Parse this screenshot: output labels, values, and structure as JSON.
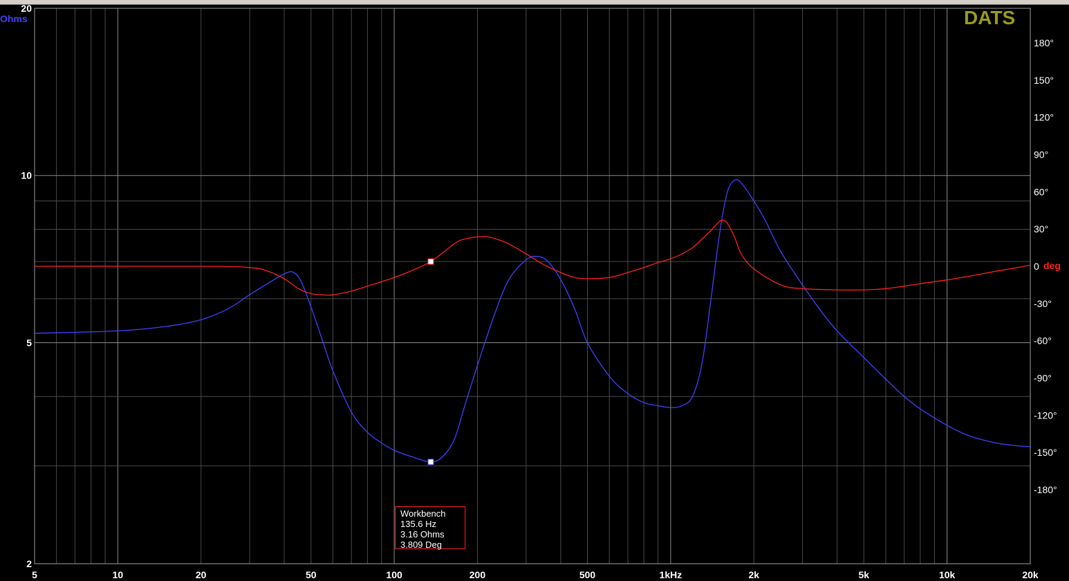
{
  "brand": "DATS",
  "chart_data": {
    "type": "line",
    "y_left_label": "Ohms",
    "y_right_label": "deg",
    "x_scale": "log",
    "y_left_scale": "log",
    "xlim": [
      5,
      20000
    ],
    "ylim_left": [
      2,
      20
    ],
    "ylim_right": [
      -180,
      180
    ],
    "grid": true,
    "x_ticks": [
      {
        "value": 5,
        "label": "5"
      },
      {
        "value": 10,
        "label": "10"
      },
      {
        "value": 20,
        "label": "20"
      },
      {
        "value": 50,
        "label": "50"
      },
      {
        "value": 100,
        "label": "100"
      },
      {
        "value": 200,
        "label": "200"
      },
      {
        "value": 500,
        "label": "500"
      },
      {
        "value": 1000,
        "label": "1kHz"
      },
      {
        "value": 2000,
        "label": "2k"
      },
      {
        "value": 5000,
        "label": "5k"
      },
      {
        "value": 10000,
        "label": "10k"
      },
      {
        "value": 20000,
        "label": "20k"
      }
    ],
    "y_left_ticks": [
      {
        "value": 20,
        "label": "20"
      },
      {
        "value": 10,
        "label": "10"
      },
      {
        "value": 5,
        "label": "5"
      },
      {
        "value": 2,
        "label": "2"
      }
    ],
    "y_right_ticks": [
      {
        "value": 180,
        "label": "180°"
      },
      {
        "value": 150,
        "label": "150°"
      },
      {
        "value": 120,
        "label": "120°"
      },
      {
        "value": 90,
        "label": "90°"
      },
      {
        "value": 60,
        "label": "60°"
      },
      {
        "value": 30,
        "label": "30°"
      },
      {
        "value": 0,
        "label": "0"
      },
      {
        "value": -30,
        "label": "-30°"
      },
      {
        "value": -60,
        "label": "-60°"
      },
      {
        "value": -90,
        "label": "-90°"
      },
      {
        "value": -120,
        "label": "-120°"
      },
      {
        "value": -150,
        "label": "-150°"
      },
      {
        "value": -180,
        "label": "-180°"
      }
    ],
    "series": [
      {
        "color": "#4040ff",
        "axis": "left",
        "points": [
          [
            5,
            5.2
          ],
          [
            10,
            5.25
          ],
          [
            15,
            5.35
          ],
          [
            20,
            5.5
          ],
          [
            25,
            5.75
          ],
          [
            30,
            6.1
          ],
          [
            35,
            6.4
          ],
          [
            40,
            6.65
          ],
          [
            43,
            6.7
          ],
          [
            46,
            6.45
          ],
          [
            50,
            5.8
          ],
          [
            55,
            5.05
          ],
          [
            60,
            4.45
          ],
          [
            70,
            3.75
          ],
          [
            80,
            3.45
          ],
          [
            90,
            3.3
          ],
          [
            100,
            3.2
          ],
          [
            115,
            3.12
          ],
          [
            135.6,
            3.05
          ],
          [
            150,
            3.12
          ],
          [
            165,
            3.35
          ],
          [
            180,
            3.85
          ],
          [
            200,
            4.55
          ],
          [
            230,
            5.6
          ],
          [
            260,
            6.5
          ],
          [
            300,
            7.05
          ],
          [
            330,
            7.15
          ],
          [
            360,
            7.0
          ],
          [
            400,
            6.5
          ],
          [
            450,
            5.75
          ],
          [
            500,
            5.0
          ],
          [
            600,
            4.35
          ],
          [
            700,
            4.05
          ],
          [
            800,
            3.9
          ],
          [
            900,
            3.85
          ],
          [
            1000,
            3.82
          ],
          [
            1100,
            3.85
          ],
          [
            1200,
            4.0
          ],
          [
            1300,
            4.6
          ],
          [
            1400,
            6.0
          ],
          [
            1500,
            7.8
          ],
          [
            1600,
            9.3
          ],
          [
            1700,
            9.8
          ],
          [
            1800,
            9.7
          ],
          [
            2000,
            9.0
          ],
          [
            2200,
            8.3
          ],
          [
            2500,
            7.3
          ],
          [
            3000,
            6.35
          ],
          [
            3500,
            5.7
          ],
          [
            4000,
            5.25
          ],
          [
            5000,
            4.7
          ],
          [
            6000,
            4.3
          ],
          [
            7000,
            4.0
          ],
          [
            8000,
            3.8
          ],
          [
            10000,
            3.55
          ],
          [
            12000,
            3.4
          ],
          [
            15000,
            3.3
          ],
          [
            18000,
            3.26
          ],
          [
            20000,
            3.25
          ]
        ]
      },
      {
        "color": "#ff2020",
        "axis": "right",
        "points": [
          [
            5,
            0
          ],
          [
            20,
            0
          ],
          [
            30,
            -1
          ],
          [
            35,
            -4
          ],
          [
            40,
            -10
          ],
          [
            45,
            -18
          ],
          [
            50,
            -22
          ],
          [
            55,
            -23
          ],
          [
            60,
            -23
          ],
          [
            70,
            -20
          ],
          [
            80,
            -16
          ],
          [
            100,
            -9
          ],
          [
            120,
            -2
          ],
          [
            135.6,
            3.8
          ],
          [
            150,
            11
          ],
          [
            170,
            20
          ],
          [
            190,
            23
          ],
          [
            210,
            24
          ],
          [
            230,
            22.5
          ],
          [
            260,
            18
          ],
          [
            300,
            10
          ],
          [
            350,
            1
          ],
          [
            400,
            -5
          ],
          [
            450,
            -9
          ],
          [
            500,
            -10
          ],
          [
            600,
            -9
          ],
          [
            700,
            -5
          ],
          [
            800,
            -1
          ],
          [
            900,
            3
          ],
          [
            1000,
            6
          ],
          [
            1100,
            10
          ],
          [
            1200,
            15
          ],
          [
            1300,
            22
          ],
          [
            1400,
            29
          ],
          [
            1500,
            36
          ],
          [
            1550,
            37
          ],
          [
            1600,
            35
          ],
          [
            1700,
            24
          ],
          [
            1800,
            10
          ],
          [
            2000,
            -2
          ],
          [
            2500,
            -15
          ],
          [
            3000,
            -18
          ],
          [
            4000,
            -19
          ],
          [
            5000,
            -19
          ],
          [
            6000,
            -18
          ],
          [
            7000,
            -16
          ],
          [
            8000,
            -14
          ],
          [
            10000,
            -11
          ],
          [
            12000,
            -8
          ],
          [
            15000,
            -4
          ],
          [
            18000,
            -1
          ],
          [
            20000,
            1
          ]
        ]
      }
    ],
    "markers": [
      [
        135.6,
        3.16
      ]
    ],
    "readout": {
      "name": "Workbench",
      "freq": "135.6 Hz",
      "ohms": "3.16 Ohms",
      "deg": "3.809 Deg"
    }
  }
}
